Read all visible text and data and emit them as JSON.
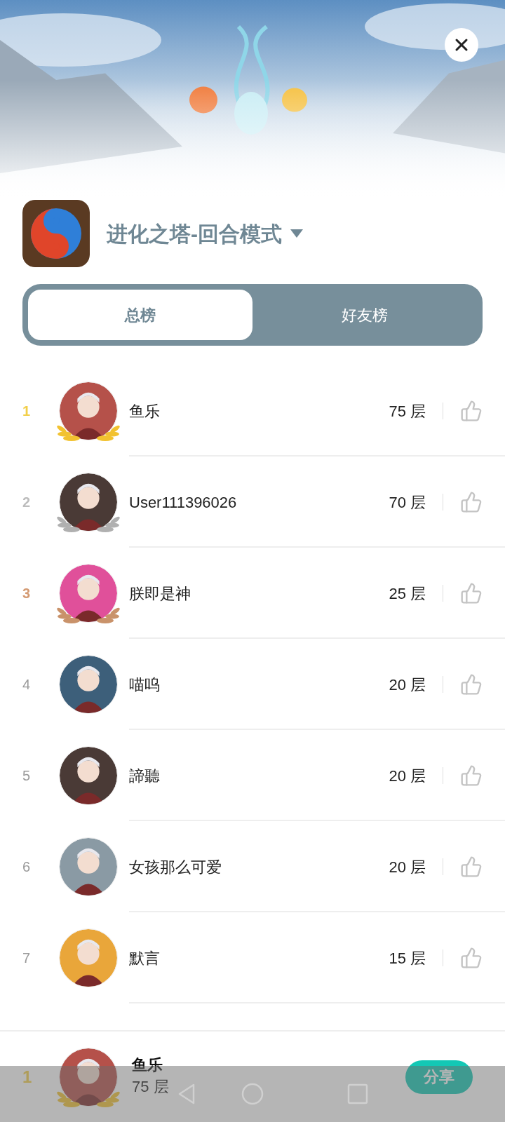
{
  "header": {
    "game_title": "进化之塔-回合模式"
  },
  "tabs": [
    {
      "label": "总榜",
      "selected": true
    },
    {
      "label": "好友榜",
      "selected": false
    }
  ],
  "rows": [
    {
      "rank": "1",
      "kind": "gold",
      "name": "鱼乐",
      "score": "75 层"
    },
    {
      "rank": "2",
      "kind": "silver",
      "name": "User111396026",
      "score": "70 层"
    },
    {
      "rank": "3",
      "kind": "bronze",
      "name": "朕即是神",
      "score": "25 层"
    },
    {
      "rank": "4",
      "kind": "plain",
      "name": "喵呜",
      "score": "20 层"
    },
    {
      "rank": "5",
      "kind": "plain",
      "name": "諦聽",
      "score": "20 层"
    },
    {
      "rank": "6",
      "kind": "plain",
      "name": "女孩那么可爱",
      "score": "20 层"
    },
    {
      "rank": "7",
      "kind": "plain",
      "name": "默言",
      "score": "15 层"
    }
  ],
  "me": {
    "rank": "1",
    "kind": "gold",
    "name": "鱼乐",
    "score": "75 层"
  },
  "share_button": "分享"
}
